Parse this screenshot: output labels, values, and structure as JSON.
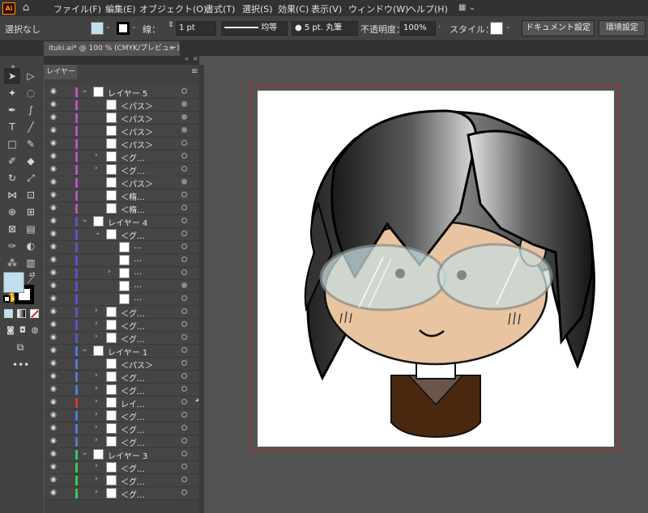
{
  "app": {
    "logo_text": "Ai"
  },
  "menu": [
    "ファイル(F)",
    "編集(E)",
    "オブジェクト(O)",
    "書式(T)",
    "選択(S)",
    "効果(C)",
    "表示(V)",
    "ウィンドウ(W)",
    "ヘルプ(H)"
  ],
  "control": {
    "selection": "選択なし",
    "stroke_label": "線：",
    "stroke_weight": "1 pt",
    "profile": "均等",
    "brush": "5 pt. 丸筆",
    "opacity_label": "不透明度：",
    "opacity": "100%",
    "style_label": "スタイル：",
    "doc_settings": "ドキュメント設定",
    "prefs": "環境設定",
    "fill_color": "#bfe0ee"
  },
  "document_tab": {
    "title": "ituki.ai* @ 100 % (CMYK/プレビュー)",
    "close": "×"
  },
  "layers_panel": {
    "tab": "レイヤー",
    "rows": [
      {
        "name": "レイヤー 5",
        "level": 0,
        "color": "#c04fc0",
        "expanded": true,
        "target": "ring"
      },
      {
        "name": "＜パス＞",
        "level": 1,
        "color": "#c04fc0",
        "target": "fill"
      },
      {
        "name": "＜パス＞",
        "level": 1,
        "color": "#c04fc0",
        "target": "fill"
      },
      {
        "name": "＜パス＞",
        "level": 1,
        "color": "#c04fc0",
        "target": "fill"
      },
      {
        "name": "＜パス＞",
        "level": 1,
        "color": "#c04fc0",
        "target": "ring"
      },
      {
        "name": "＜グ…",
        "level": 1,
        "color": "#c04fc0",
        "collapsed": true,
        "target": "ring"
      },
      {
        "name": "＜グ…",
        "level": 1,
        "color": "#c04fc0",
        "collapsed": true,
        "target": "ring"
      },
      {
        "name": "＜パス＞",
        "level": 1,
        "color": "#c04fc0",
        "target": "fill"
      },
      {
        "name": "＜楕…",
        "level": 1,
        "color": "#c04fc0",
        "target": "ring"
      },
      {
        "name": "＜楕…",
        "level": 1,
        "color": "#c04fc0",
        "target": "ring"
      },
      {
        "name": "レイヤー 4",
        "level": 0,
        "color": "#5a54c8",
        "expanded": true,
        "target": "ring"
      },
      {
        "name": "＜グ…",
        "level": 1,
        "color": "#5a54c8",
        "expanded": true,
        "target": "ring"
      },
      {
        "name": "…",
        "level": 2,
        "color": "#5a54c8",
        "target": "ring"
      },
      {
        "name": "…",
        "level": 2,
        "color": "#5a54c8",
        "target": "ring"
      },
      {
        "name": "…",
        "level": 2,
        "color": "#5a54c8",
        "collapsed": true,
        "target": "ring"
      },
      {
        "name": "…",
        "level": 2,
        "color": "#5a54c8",
        "target": "fill"
      },
      {
        "name": "…",
        "level": 2,
        "color": "#5a54c8",
        "target": "ring"
      },
      {
        "name": "＜グ…",
        "level": 1,
        "color": "#5a54c8",
        "collapsed": true,
        "target": "ring"
      },
      {
        "name": "＜グ…",
        "level": 1,
        "color": "#5a54c8",
        "collapsed": true,
        "target": "ring"
      },
      {
        "name": "＜グ…",
        "level": 1,
        "color": "#5a54c8",
        "collapsed": true,
        "target": "ring"
      },
      {
        "name": "レイヤー 1",
        "level": 0,
        "color": "#4f7ad6",
        "expanded": true,
        "target": "ring"
      },
      {
        "name": "＜パス＞",
        "level": 1,
        "color": "#4f7ad6",
        "target": "ring"
      },
      {
        "name": "＜グ…",
        "level": 1,
        "color": "#4f7ad6",
        "collapsed": true,
        "target": "ring"
      },
      {
        "name": "＜グ…",
        "level": 1,
        "color": "#4f7ad6",
        "collapsed": true,
        "target": "ring"
      },
      {
        "name": "レイ…",
        "level": 1,
        "color": "#d43a3a",
        "collapsed": true,
        "target": "ring"
      },
      {
        "name": "＜グ…",
        "level": 1,
        "color": "#4f7ad6",
        "collapsed": true,
        "target": "ring"
      },
      {
        "name": "＜グ…",
        "level": 1,
        "color": "#4f7ad6",
        "collapsed": true,
        "target": "ring"
      },
      {
        "name": "＜グ…",
        "level": 1,
        "color": "#4f7ad6",
        "collapsed": true,
        "target": "ring"
      },
      {
        "name": "レイヤー 3",
        "level": 0,
        "color": "#3fc45a",
        "expanded": true,
        "target": "ring"
      },
      {
        "name": "＜グ…",
        "level": 1,
        "color": "#3fc45a",
        "collapsed": true,
        "target": "ring"
      },
      {
        "name": "＜グ…",
        "level": 1,
        "color": "#3fc45a",
        "collapsed": true,
        "target": "ring"
      },
      {
        "name": "＜グ…",
        "level": 1,
        "color": "#3fc45a",
        "collapsed": true,
        "target": "ring"
      }
    ]
  },
  "colors": {
    "artboard_border": "#b82a2a",
    "skin": "#e8c4a0",
    "glasses": "#c8dcdc",
    "shirt": "#4a2810"
  }
}
